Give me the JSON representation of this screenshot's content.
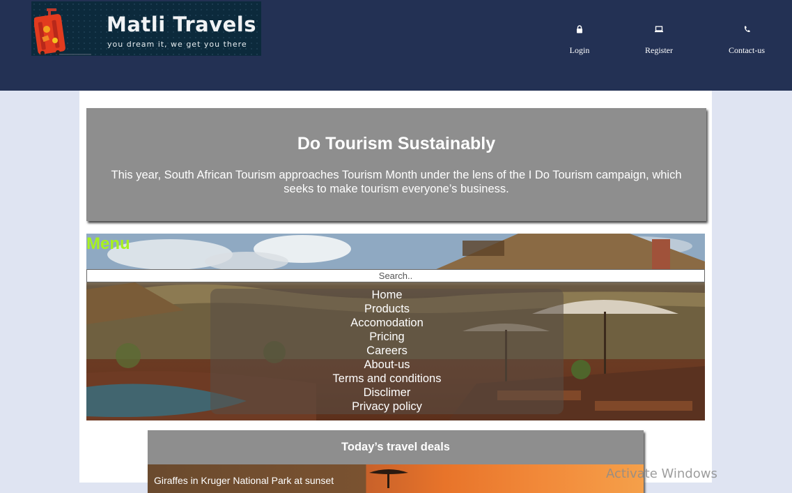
{
  "header": {
    "brand": "Matli Travels",
    "tagline": "you dream it, we get you there",
    "nav": [
      {
        "label": "Login",
        "icon": "lock-icon"
      },
      {
        "label": "Register",
        "icon": "laptop-icon"
      },
      {
        "label": "Contact-us",
        "icon": "phone-icon"
      }
    ],
    "background_color": "#233154"
  },
  "hero": {
    "title": "Do Tourism Sustainably",
    "text": "This year, South African Tourism approaches Tourism Month under the lens of the I Do Tourism campaign, which seeks to make tourism everyone’s business."
  },
  "menu": {
    "title": "Menu",
    "search_placeholder": "Search..",
    "items": [
      "Home",
      "Products",
      "Accomodation",
      "Pricing",
      "Careers",
      "About-us",
      "Terms and conditions",
      "Disclimer",
      "Privacy policy"
    ],
    "title_color": "#a8f11f"
  },
  "deals": {
    "title": "Today’s travel deals",
    "first_caption": "Giraffes in Kruger National Park at sunset"
  },
  "system": {
    "watermark": "Activate Windows"
  }
}
